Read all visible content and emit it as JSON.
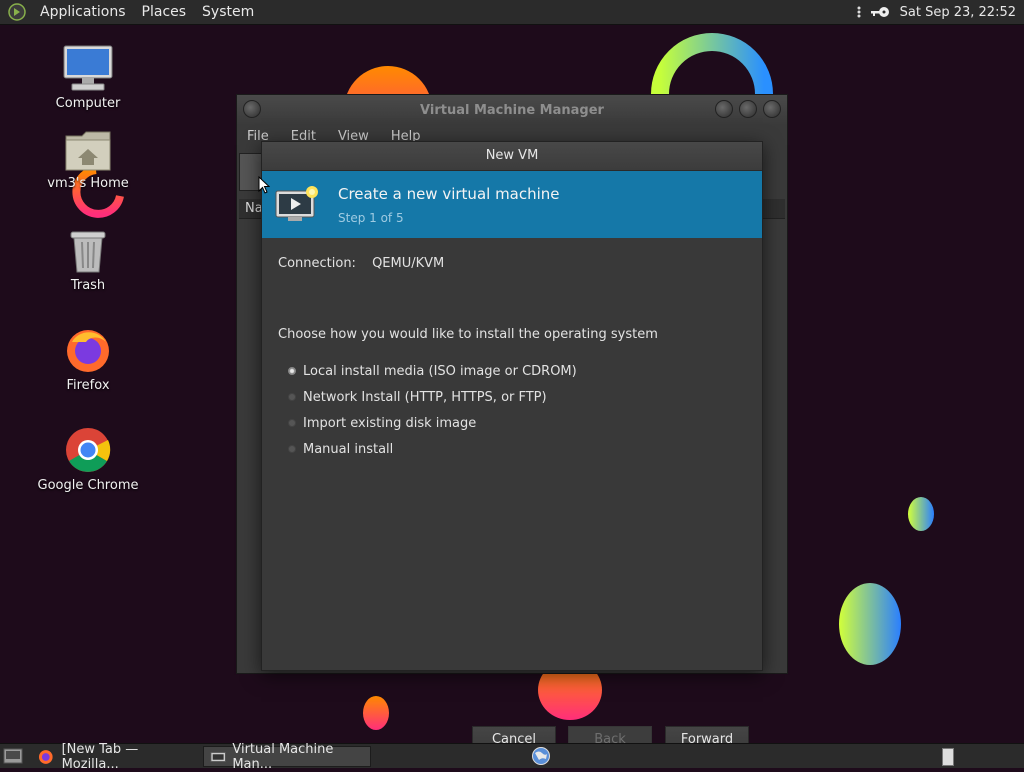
{
  "top_panel": {
    "menus": [
      "Applications",
      "Places",
      "System"
    ],
    "clock": "Sat Sep 23, 22:52",
    "icons": [
      "gnome-foot-icon",
      "key-icon",
      "network-dots-icon"
    ]
  },
  "desktop": {
    "icons": [
      {
        "label": "Computer",
        "icon": "computer-icon"
      },
      {
        "label": "vm3's Home",
        "icon": "home-folder-icon"
      },
      {
        "label": "Trash",
        "icon": "trash-icon"
      },
      {
        "label": "Firefox",
        "icon": "firefox-icon"
      },
      {
        "label": "Google Chrome",
        "icon": "chrome-icon"
      }
    ]
  },
  "vmm_window": {
    "title": "Virtual Machine Manager",
    "menus": [
      "File",
      "Edit",
      "View",
      "Help"
    ],
    "column_header": "Na"
  },
  "dialog": {
    "title": "New VM",
    "header_title": "Create a new virtual machine",
    "header_step": "Step 1 of 5",
    "connection_label": "Connection:",
    "connection_value": "QEMU/KVM",
    "choose_label": "Choose how you would like to install the operating system",
    "options": [
      {
        "label": "Local install media (ISO image or CDROM)",
        "selected": true
      },
      {
        "label": "Network Install (HTTP, HTTPS, or FTP)",
        "selected": false
      },
      {
        "label": "Import existing disk image",
        "selected": false
      },
      {
        "label": "Manual install",
        "selected": false
      }
    ],
    "buttons": {
      "cancel": "Cancel",
      "back": "Back",
      "forward": "Forward"
    },
    "header_color": "#1578a8"
  },
  "taskbar": {
    "tasks": [
      {
        "label": "[New Tab — Mozilla...",
        "icon": "firefox-icon",
        "active": false
      },
      {
        "label": "Virtual Machine Man...",
        "icon": "vmm-icon",
        "active": true
      }
    ]
  }
}
